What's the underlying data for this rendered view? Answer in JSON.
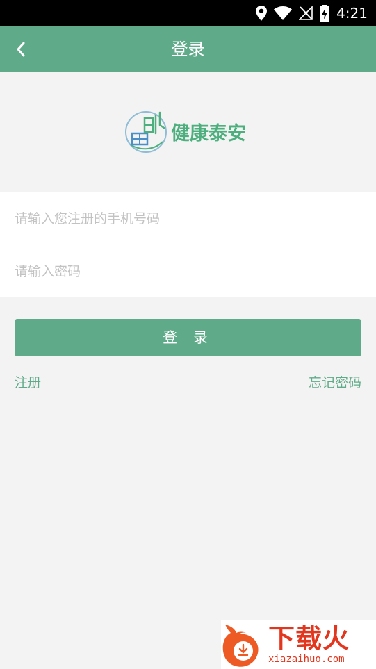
{
  "status_bar": {
    "time": "4:21",
    "icons": [
      "location-icon",
      "wifi-icon",
      "no-signal-icon",
      "battery-charging-icon"
    ]
  },
  "nav": {
    "title": "登录",
    "back_icon": "chevron-left-icon"
  },
  "logo": {
    "text": "健康泰安"
  },
  "form": {
    "phone_placeholder": "请输入您注册的手机号码",
    "phone_value": "",
    "password_placeholder": "请输入密码",
    "password_value": ""
  },
  "actions": {
    "login_label": "登 录",
    "register_label": "注册",
    "forgot_label": "忘记密码"
  },
  "watermark": {
    "cn": "下载火",
    "en": "xiazaihuo.com"
  },
  "colors": {
    "primary": "#5fab89",
    "background": "#f3f3f3",
    "watermark": "#e2371e"
  }
}
